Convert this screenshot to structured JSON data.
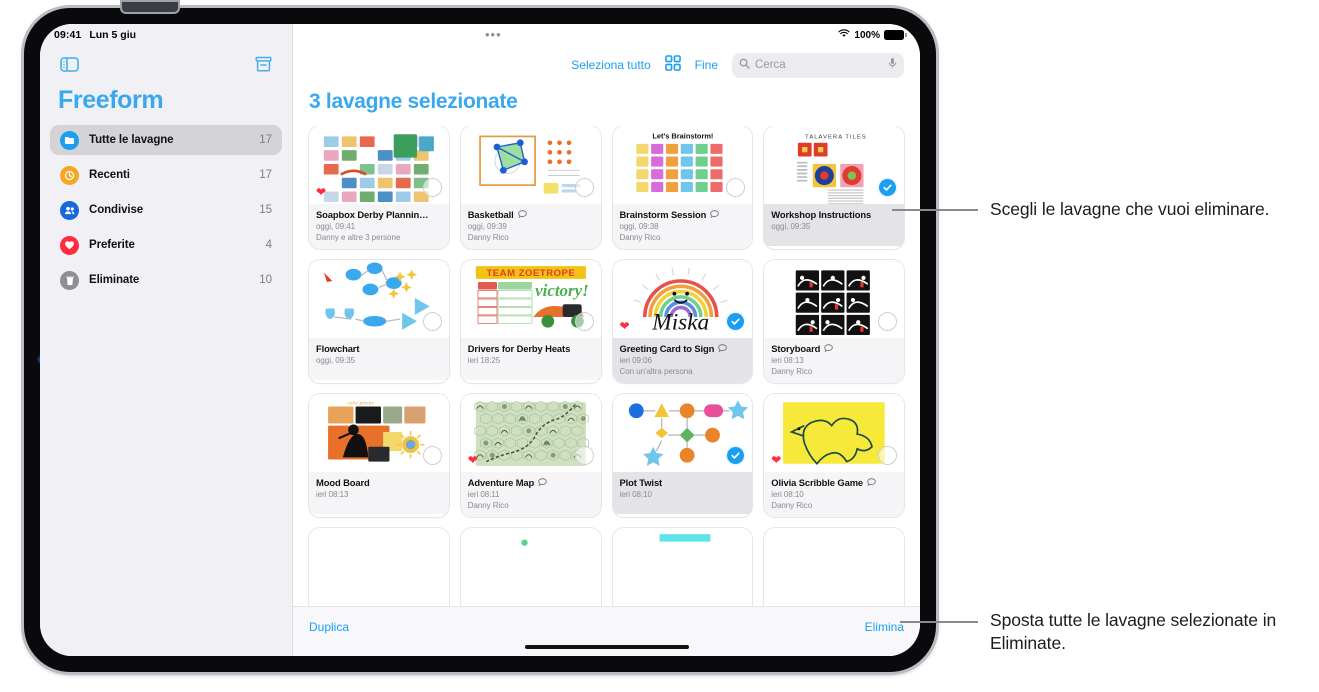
{
  "status_bar": {
    "time": "09:41",
    "date": "Lun 5 giu",
    "dots": "•••",
    "battery_percent": "100%",
    "wifi_icon": "wifi-icon",
    "battery_icon": "battery-icon"
  },
  "sidebar": {
    "toggle_icon": "sidebar-toggle-icon",
    "archive_icon": "archive-box-icon",
    "title": "Freeform",
    "items": [
      {
        "label": "Tutte le lavagne",
        "count": "17",
        "icon": "all-boards-icon",
        "color": "#1a9ff0",
        "selected": true
      },
      {
        "label": "Recenti",
        "count": "17",
        "icon": "clock-icon",
        "color": "#f5a623",
        "selected": false
      },
      {
        "label": "Condivise",
        "count": "15",
        "icon": "people-icon",
        "color": "#1867dc",
        "selected": false
      },
      {
        "label": "Preferite",
        "count": "4",
        "icon": "heart-icon",
        "color": "#ff2d3f",
        "selected": false
      },
      {
        "label": "Eliminate",
        "count": "10",
        "icon": "trash-icon",
        "color": "#8e8e93",
        "selected": false
      }
    ]
  },
  "toolbar": {
    "select_all_label": "Seleziona tutto",
    "grid_icon": "grid-view-icon",
    "done_label": "Fine",
    "search_icon": "search-icon",
    "search_placeholder": "Cerca",
    "search_value": "",
    "mic_icon": "microphone-icon"
  },
  "main": {
    "heading": "3 lavagne selezionate"
  },
  "boards": [
    {
      "title": "Soapbox Derby Plannin…",
      "date": "oggi, 09:41",
      "people": "Danny e altre 3 persone",
      "selected": false,
      "favorite": true,
      "shared": false,
      "thumb": "collage"
    },
    {
      "title": "Basketball",
      "date": "oggi, 09:39",
      "people": "Danny Rico",
      "selected": false,
      "favorite": false,
      "shared": true,
      "thumb": "basketball"
    },
    {
      "title": "Brainstorm Session",
      "date": "oggi, 09:38",
      "people": "Danny Rico",
      "selected": false,
      "favorite": false,
      "shared": true,
      "thumb": "stickies"
    },
    {
      "title": "Workshop Instructions",
      "date": "oggi, 09:35",
      "people": "",
      "selected": true,
      "favorite": false,
      "shared": false,
      "thumb": "tiles"
    },
    {
      "title": "Flowchart",
      "date": "oggi, 09:35",
      "people": "",
      "selected": false,
      "favorite": false,
      "shared": false,
      "thumb": "flowchart"
    },
    {
      "title": "Drivers for Derby Heats",
      "date": "ieri 18:25",
      "people": "",
      "selected": false,
      "favorite": false,
      "shared": false,
      "thumb": "derby"
    },
    {
      "title": "Greeting Card to Sign",
      "date": "ieri 09:06",
      "people": "Con un'altra persona",
      "selected": true,
      "favorite": true,
      "shared": true,
      "thumb": "rainbow"
    },
    {
      "title": "Storyboard",
      "date": "ieri 08:13",
      "people": "Danny Rico",
      "selected": false,
      "favorite": false,
      "shared": true,
      "thumb": "storyboard"
    },
    {
      "title": "Mood Board",
      "date": "ieri 08:13",
      "people": "",
      "selected": false,
      "favorite": false,
      "shared": false,
      "thumb": "moodboard"
    },
    {
      "title": "Adventure Map",
      "date": "ieri 08:11",
      "people": "Danny Rico",
      "selected": false,
      "favorite": true,
      "shared": true,
      "thumb": "map"
    },
    {
      "title": "Plot Twist",
      "date": "ieri 08:10",
      "people": "",
      "selected": true,
      "favorite": false,
      "shared": false,
      "thumb": "plot"
    },
    {
      "title": "Olivia Scribble Game",
      "date": "ieri 08:10",
      "people": "Danny Rico",
      "selected": false,
      "favorite": true,
      "shared": true,
      "thumb": "scribble"
    }
  ],
  "bottom_bar": {
    "duplicate_label": "Duplica",
    "delete_label": "Elimina"
  },
  "callouts": {
    "top": "Scegli le lavagne che vuoi eliminare.",
    "bottom": "Sposta tutte le lavagne selezionate in Eliminate."
  }
}
